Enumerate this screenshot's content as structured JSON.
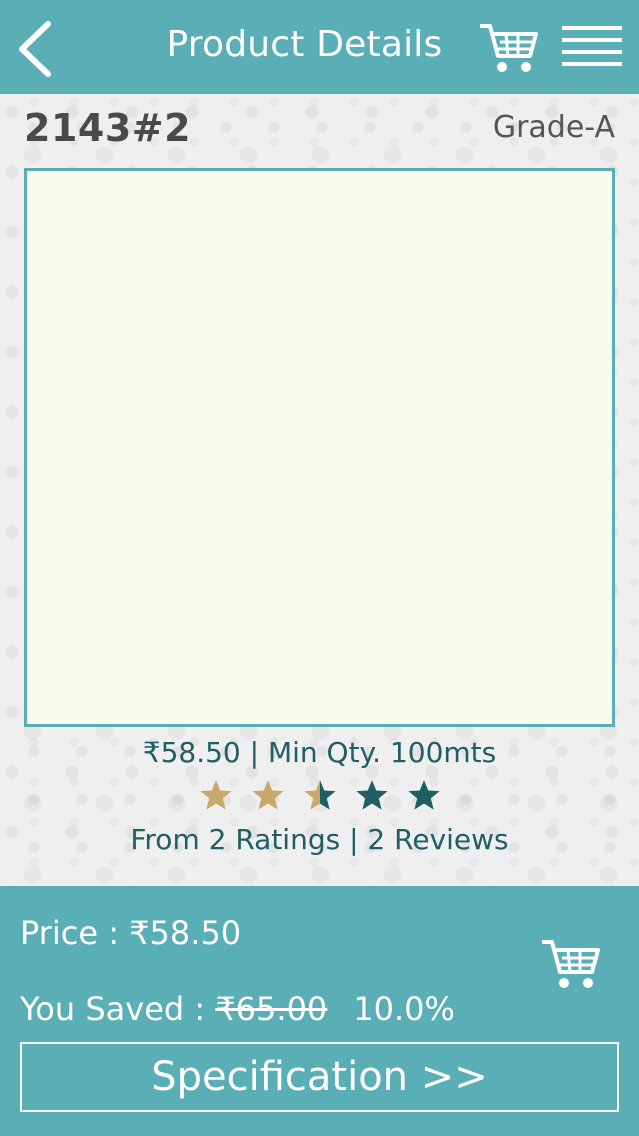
{
  "header": {
    "title": "Product Details",
    "back_icon": "chevron-left-icon",
    "cart_icon": "cart-icon",
    "menu_icon": "hamburger-menu-icon"
  },
  "product": {
    "code": "2143#2",
    "grade": "Grade-A",
    "price_line": "₹58.50 | Min Qty. 100mts",
    "rating": 2.5,
    "rating_max": 5,
    "ratings_line": "From 2 Ratings | 2 Reviews"
  },
  "footer": {
    "price_prefix": "Price : ",
    "price": "₹58.50",
    "saved_prefix": "You Saved : ",
    "original_price": "₹65.00",
    "discount_percent": "10.0%",
    "specification_label": "Specification >>",
    "add_cart_icon": "cart-icon"
  },
  "colors": {
    "accent": "#5aaeb5",
    "text_dark_teal": "#1f5e63",
    "star_filled": "#c8a86b",
    "star_empty": "#1f5e63",
    "image_bg": "#f8fdec"
  }
}
